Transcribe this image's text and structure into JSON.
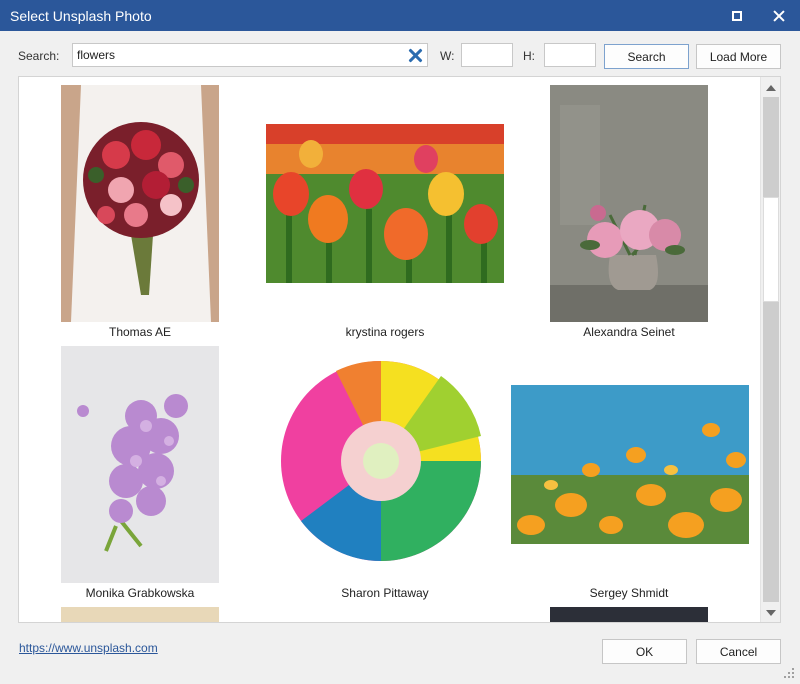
{
  "window": {
    "title": "Select Unsplash Photo",
    "accent_color": "#2b579a",
    "maximize_icon": "maximize-icon",
    "close_icon": "close-icon"
  },
  "search": {
    "label": "Search:",
    "value": "flowers",
    "clear_icon": "clear-icon",
    "width_label": "W:",
    "width_value": "",
    "height_label": "H:",
    "height_value": "",
    "search_button": "Search",
    "load_more_button": "Load More"
  },
  "photos": [
    {
      "author": "Thomas AE",
      "subject": "bridal bouquet of red and pink roses"
    },
    {
      "author": "krystina rogers",
      "subject": "field of red and yellow tulips"
    },
    {
      "author": "Alexandra Seinet",
      "subject": "pink peonies in a stone vase"
    },
    {
      "author": "Monika Grabkowska",
      "subject": "purple lilac sprig"
    },
    {
      "author": "Sharon Pittaway",
      "subject": "rainbow chrysanthemum"
    },
    {
      "author": "Sergey Shmidt",
      "subject": "orange poppies under blue sky"
    }
  ],
  "footer": {
    "link": "https://www.unsplash.com",
    "ok_button": "OK",
    "cancel_button": "Cancel"
  }
}
